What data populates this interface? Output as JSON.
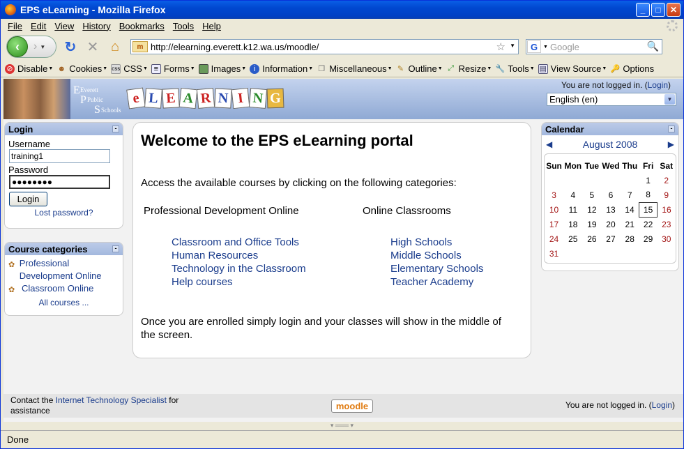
{
  "window": {
    "title": "EPS eLearning - Mozilla Firefox"
  },
  "menu": [
    "File",
    "Edit",
    "View",
    "History",
    "Bookmarks",
    "Tools",
    "Help"
  ],
  "address": {
    "url": "http://elearning.everett.k12.wa.us/moodle/"
  },
  "search": {
    "engine": "G",
    "placeholder": "Google"
  },
  "devtoolbar": [
    "Disable",
    "Cookies",
    "CSS",
    "Forms",
    "Images",
    "Information",
    "Miscellaneous",
    "Outline",
    "Resize",
    "Tools",
    "View Source",
    "Options"
  ],
  "header": {
    "not_logged_prefix": "You are not logged in. (",
    "login_link": "Login",
    "not_logged_suffix": ")",
    "language": "English (en)",
    "logo_text": [
      "e",
      "L",
      "E",
      "A",
      "R",
      "N",
      "I",
      "N",
      "G"
    ],
    "eps_lines": [
      "Everett",
      "Public",
      "Schools"
    ]
  },
  "login": {
    "title": "Login",
    "username_label": "Username",
    "username_value": "training1",
    "password_label": "Password",
    "password_value": "●●●●●●●●",
    "button": "Login",
    "lost": "Lost password?"
  },
  "categories": {
    "title": "Course categories",
    "items": [
      "Professional Development Online",
      "Classroom Online"
    ],
    "all": "All courses ..."
  },
  "main": {
    "heading": "Welcome to the EPS eLearning portal",
    "intro": "Access the available courses by clicking on the following categories:",
    "col1_title": "Professional Development Online",
    "col1_links": [
      "Classroom and Office Tools",
      "Human Resources",
      "Technology in the Classroom",
      "Help courses"
    ],
    "col2_title": "Online Classrooms",
    "col2_links": [
      "High Schools",
      "Middle Schools",
      "Elementary Schools",
      "Teacher Academy"
    ],
    "outro": "Once you are enrolled simply login and your classes will show in the middle of the screen."
  },
  "calendar": {
    "title": "Calendar",
    "month": "August 2008",
    "days": [
      "Sun",
      "Mon",
      "Tue",
      "Wed",
      "Thu",
      "Fri",
      "Sat"
    ],
    "weeks": [
      [
        "",
        "",
        "",
        "",
        "",
        "1",
        "2"
      ],
      [
        "3",
        "4",
        "5",
        "6",
        "7",
        "8",
        "9"
      ],
      [
        "10",
        "11",
        "12",
        "13",
        "14",
        "15",
        "16"
      ],
      [
        "17",
        "18",
        "19",
        "20",
        "21",
        "22",
        "23"
      ],
      [
        "24",
        "25",
        "26",
        "27",
        "28",
        "29",
        "30"
      ],
      [
        "31",
        "",
        "",
        "",
        "",
        "",
        ""
      ]
    ],
    "today": "15"
  },
  "footer": {
    "contact_prefix": "Contact the ",
    "contact_link": "Internet Technology Specialist",
    "contact_suffix": " for assistance",
    "logo": "moodle",
    "not_logged_prefix": "You are not logged in. (",
    "login_link": "Login",
    "not_logged_suffix": ")"
  },
  "status": "Done"
}
